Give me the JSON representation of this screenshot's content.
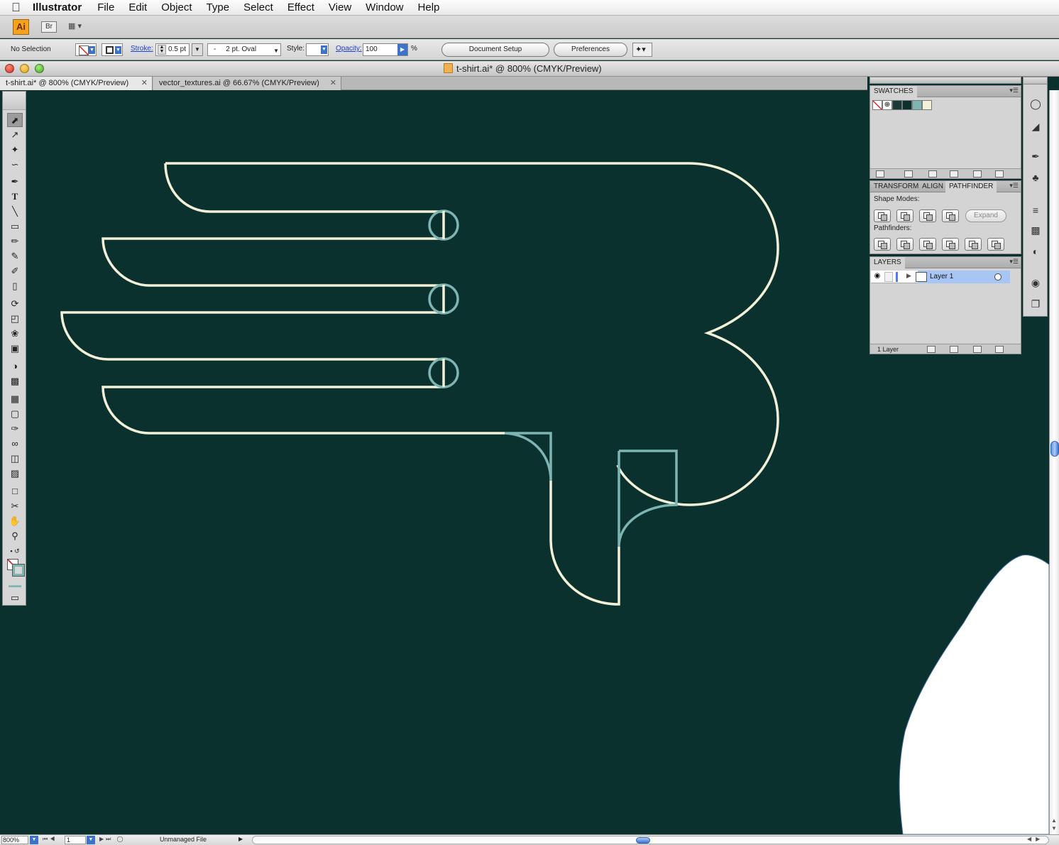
{
  "menubar": {
    "app_name": "Illustrator",
    "menus": [
      "File",
      "Edit",
      "Object",
      "Type",
      "Select",
      "Effect",
      "View",
      "Window",
      "Help"
    ]
  },
  "appbar": {
    "logo_label": "Ai",
    "bridge_label": "Br"
  },
  "control_bar": {
    "selection_status": "No Selection",
    "stroke_label": "Stroke:",
    "stroke_weight": "0.5 pt",
    "brush_value": "2 pt. Oval",
    "brush_dash": "-",
    "style_label": "Style:",
    "opacity_label": "Opacity:",
    "opacity_value": "100",
    "percent_sign": "%",
    "document_setup_label": "Document Setup",
    "preferences_label": "Preferences"
  },
  "window": {
    "title": "t-shirt.ai* @ 800% (CMYK/Preview)"
  },
  "tabs": [
    {
      "label": "t-shirt.ai* @ 800% (CMYK/Preview)",
      "active": true
    },
    {
      "label": "vector_textures.ai @ 66.67% (CMYK/Preview)",
      "active": false
    }
  ],
  "canvas": {
    "background_color": "#0b312f",
    "cream_stroke_color": "#f3f0d8",
    "teal_stroke_color": "#7db5b2"
  },
  "swatches_panel": {
    "title": "SWATCHES",
    "swatch_colors": [
      "none",
      "registration",
      "#1b3a38",
      "#0b312f",
      "#7db5b2",
      "#f3f0d8"
    ]
  },
  "pathfinder_panel": {
    "tabs": [
      "TRANSFORM",
      "ALIGN",
      "PATHFINDER"
    ],
    "active_tab": "PATHFINDER",
    "shape_modes_label": "Shape Modes:",
    "pathfinders_label": "Pathfinders:",
    "expand_label": "Expand"
  },
  "layers_panel": {
    "title": "LAYERS",
    "layers": [
      {
        "name": "Layer 1"
      }
    ],
    "count_label": "1 Layer"
  },
  "status_bar": {
    "zoom": "800%",
    "page": "1",
    "file_status": "Unmanaged File"
  }
}
